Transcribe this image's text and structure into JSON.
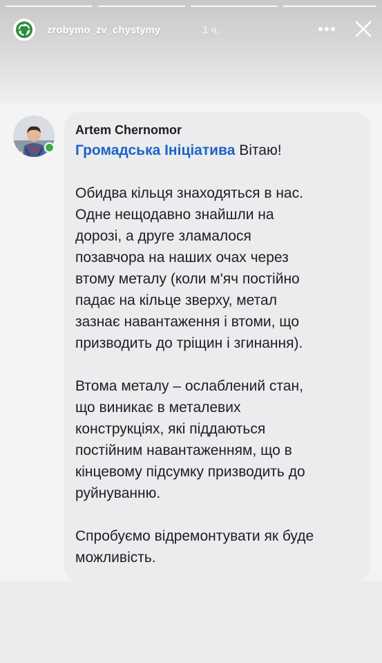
{
  "story": {
    "username": "zrobymo_zv_chystymy",
    "time": "1 ч.",
    "avatar_icon": "recycle-logo-icon",
    "more_icon": "more-horizontal-icon",
    "close_icon": "close-icon",
    "progress_segments": 4,
    "progress_current": 4
  },
  "comment": {
    "author": "Artem Chernomor",
    "avatar_icon": "profile-photo",
    "online": true,
    "mention": "Громадська Ініціатива",
    "greeting": "Вітаю!",
    "paragraphs": [
      "Обидва кільця знаходяться в нас.\nОдне нещодавно знайшли на\nдорозі, а друге зламалося\nпозавчора на наших очах через\nвтому металу (коли м'яч постійно\nпадає на кільце зверху, метал\nзазнає навантаження і втоми, що\nпризводить до тріщин і згинання).",
      "Втома металу – ослаблений стан,\nщо виникає в металевих\nконструкціях, які піддаються\nпостійним навантаженням, що в\nкінцевому підсумку призводить до\nруйнуванню.",
      "Спробуємо відремонтувати як буде\nможливість."
    ]
  },
  "colors": {
    "mention": "#1b63c9",
    "online": "#3ea84a",
    "bubble": "#ececee",
    "logo": "#2e8b3e"
  }
}
